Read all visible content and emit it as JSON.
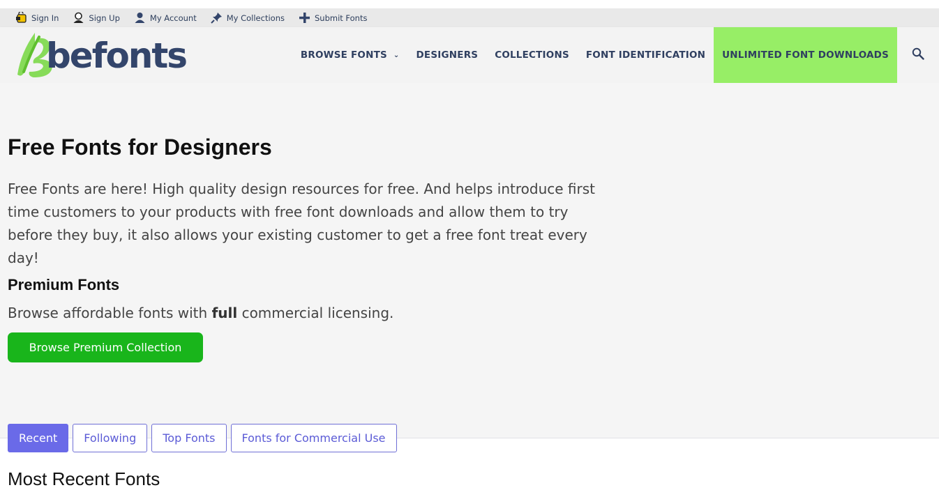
{
  "utility_bar": {
    "items": [
      {
        "label": "Sign In",
        "icon": "sign-in-icon"
      },
      {
        "label": "Sign Up",
        "icon": "sign-up-icon"
      },
      {
        "label": "My Account",
        "icon": "account-icon"
      },
      {
        "label": "My Collections",
        "icon": "pin-icon"
      },
      {
        "label": "Submit Fonts",
        "icon": "plus-icon"
      }
    ]
  },
  "header": {
    "logo_text": "befonts",
    "nav": {
      "browse_fonts": "BROWSE FONTS",
      "designers": "DESIGNERS",
      "collections": "COLLECTIONS",
      "font_identification": "FONT IDENTIFICATION",
      "unlimited_downloads": "UNLIMITED FONT DOWNLOADS"
    },
    "highlight_color": "#97ee66"
  },
  "hero": {
    "title": "Free Fonts for Designers",
    "text": "Free Fonts are here! High quality design resources for free. And helps introduce first time customers to your products with free font downloads and allow them to try before they buy, it also allows your existing customer to get a free font treat every day!",
    "premium_title": "Premium Fonts",
    "premium_text_before": "Browse affordable fonts with ",
    "premium_text_bold": "full",
    "premium_text_after": " commercial licensing.",
    "premium_button": "Browse Premium Collection",
    "button_color": "#19b51b"
  },
  "tabs": {
    "recent": "Recent",
    "following": "Following",
    "top_fonts": "Top Fonts",
    "commercial": "Fonts for Commercial Use",
    "active_color": "#6a6ae8"
  },
  "section_title": "Most Recent Fonts"
}
